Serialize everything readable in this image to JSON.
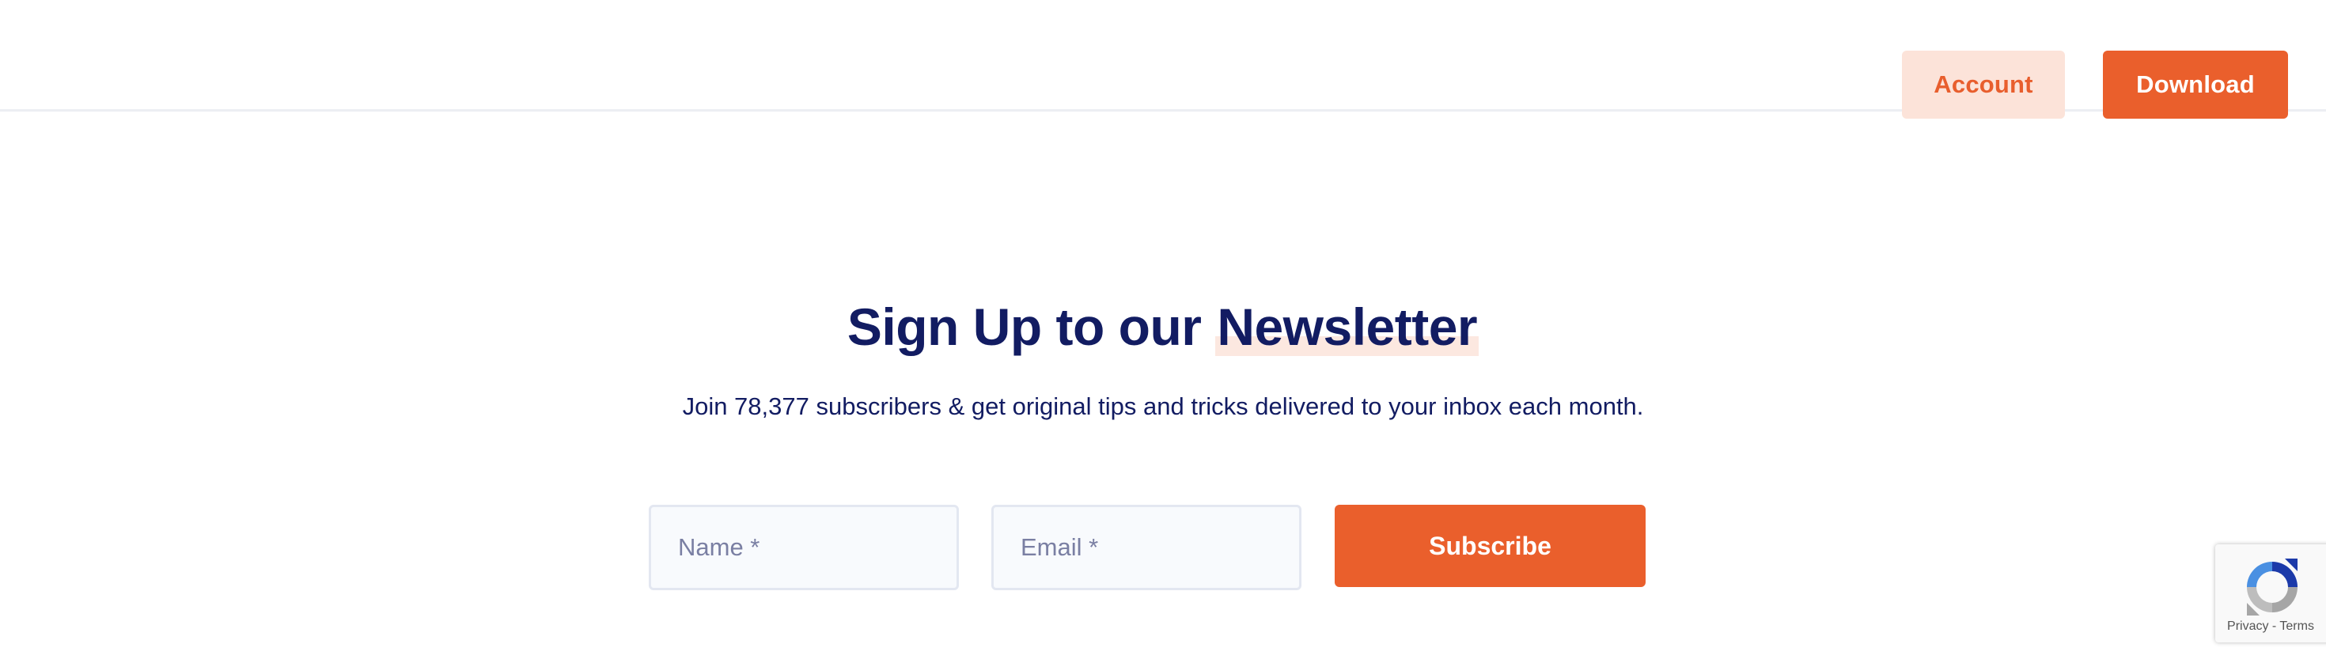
{
  "header": {
    "account_label": "Account",
    "download_label": "Download"
  },
  "newsletter": {
    "title_part1": "Sign Up to our ",
    "title_highlight": "Newsletter",
    "subtitle": "Join 78,377 subscribers & get original tips and tricks delivered to your inbox each month.",
    "name_placeholder": "Name *",
    "email_placeholder": "Email *",
    "subscribe_label": "Subscribe"
  },
  "recaptcha": {
    "privacy_label": "Privacy",
    "separator": " - ",
    "terms_label": "Terms",
    "icon": "recaptcha-icon"
  },
  "colors": {
    "accent": "#ea5f2c",
    "accent_light": "#fce3d9",
    "navy": "#121c62"
  }
}
